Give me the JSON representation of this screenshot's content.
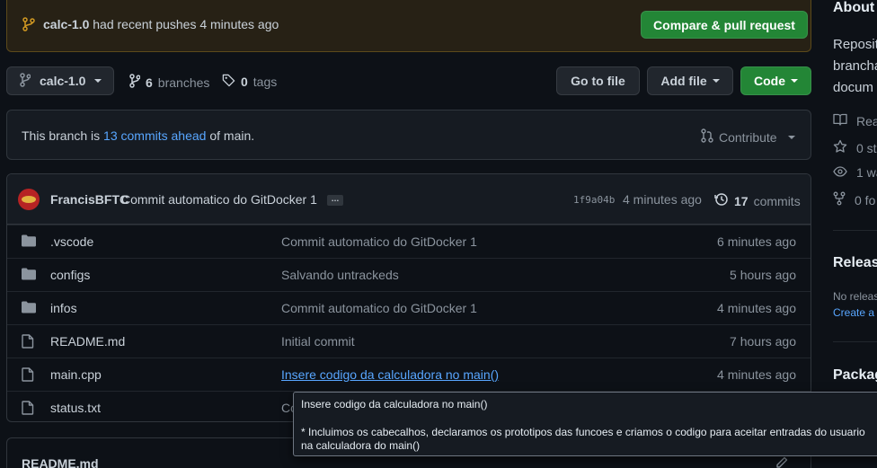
{
  "banner": {
    "branch": "calc-1.0",
    "message": " had recent pushes 4 minutes ago",
    "compare_label": "Compare & pull request"
  },
  "toolbar": {
    "branch_label": "calc-1.0",
    "branches_count": "6",
    "branches_label": "branches",
    "tags_count": "0",
    "tags_label": "tags",
    "goto_file": "Go to file",
    "add_file": "Add file",
    "code": "Code"
  },
  "ahead": {
    "prefix": "This branch is ",
    "link": "13 commits ahead",
    "suffix": " of main.",
    "contribute": "Contribute"
  },
  "latest_commit": {
    "author": "FrancisBFTC",
    "message": "Commit automatico do GitDocker 1",
    "ellipsis": "…",
    "sha": "1f9a04b",
    "time": "4 minutes ago",
    "commits_count": "17",
    "commits_label": "commits"
  },
  "files": [
    {
      "type": "folder",
      "name": ".vscode",
      "message": "Commit automatico do GitDocker 1",
      "time": "6 minutes ago"
    },
    {
      "type": "folder",
      "name": "configs",
      "message": "Salvando untrackeds",
      "time": "5 hours ago"
    },
    {
      "type": "folder",
      "name": "infos",
      "message": "Commit automatico do GitDocker 1",
      "time": "4 minutes ago"
    },
    {
      "type": "file",
      "name": "README.md",
      "message": "Initial commit",
      "time": "7 hours ago"
    },
    {
      "type": "file",
      "name": "main.cpp",
      "message": "Insere codigo da calculadora no main()",
      "time": "4 minutes ago"
    },
    {
      "type": "file",
      "name": "status.txt",
      "message": "Co",
      "time": ""
    }
  ],
  "readme": {
    "title": "README.md"
  },
  "tooltip": {
    "line1": "Insere codigo da calculadora no main()",
    "line2": "* Incluimos os cabecalhos, declaramos os prototipos das funcoes e criamos o codigo para aceitar entradas do usuario na calculadora do main()"
  },
  "sidebar": {
    "about_heading": "About",
    "about_desc": [
      "Reposit",
      "brancha",
      "docum"
    ],
    "readme_label": "Rea",
    "stars_label": "0 st",
    "watching_label": "1 wa",
    "forks_label": "0 fo",
    "releases_heading": "Releas",
    "no_releases": "No releas",
    "create_release": "Create a r",
    "packages_heading": "Packag"
  },
  "colors": {
    "background": "#0d1117",
    "accent_green": "#238636",
    "link_blue": "#58a6ff",
    "banner_bg": "#272115"
  }
}
